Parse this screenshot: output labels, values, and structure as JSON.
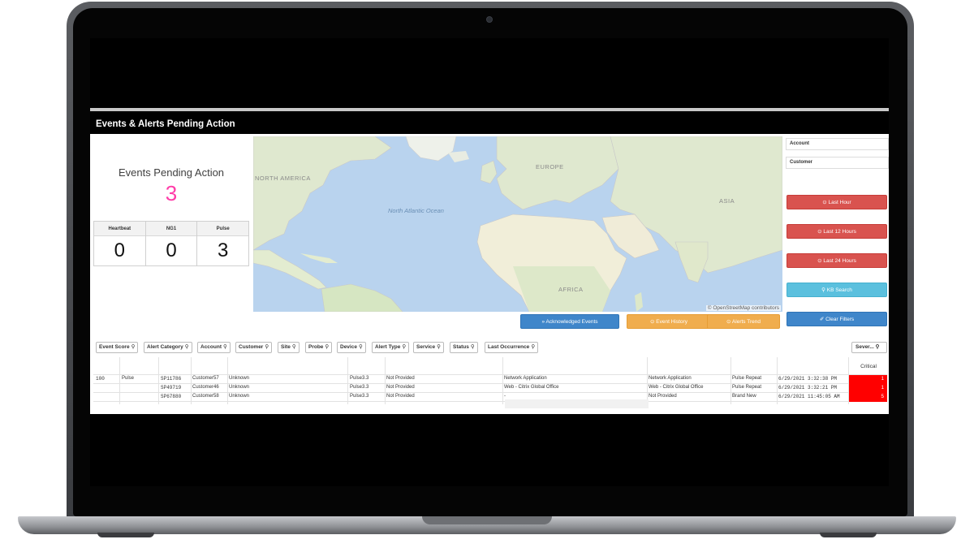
{
  "panel_title": "Events & Alerts Pending Action",
  "pending": {
    "title": "Events Pending Action",
    "value": "3",
    "value_color": "#ff3ca8"
  },
  "kpis": [
    {
      "label": "Heartbeat",
      "value": "0"
    },
    {
      "label": "NG1",
      "value": "0"
    },
    {
      "label": "Pulse",
      "value": "3"
    }
  ],
  "map": {
    "labels": {
      "north_america": "NORTH AMERICA",
      "europe": "EUROPE",
      "asia": "ASIA",
      "africa": "AFRICA"
    },
    "ocean": "North Atlantic Ocean",
    "attribution": "© OpenStreetMap contributors"
  },
  "filters": {
    "account": "Account",
    "customer": "Customer"
  },
  "buttons": {
    "last_hour": "Last Hour",
    "last_12_hours": "Last 12 Hours",
    "last_24_hours": "Last 24 Hours",
    "kb_search": "KB Search",
    "clear_filters": "Clear Filters",
    "acknowledged_events": "Acknowledged Events",
    "event_history": "Event History",
    "alerts_trend": "Alerts Trend"
  },
  "colors": {
    "red": "#d9534f",
    "cyan": "#5bc0de",
    "blue": "#3f86ca",
    "orange": "#f0ad4e",
    "severity": "#ff0000"
  },
  "table": {
    "headers": [
      "Event Score",
      "Alert Category",
      "Account",
      "Customer",
      "Site",
      "Probe",
      "Device",
      "Alert Type",
      "Service",
      "Status",
      "Last Occurrence"
    ],
    "severity_header": "Sever...",
    "severity_sub": "Critical",
    "score": "100",
    "category": "Pulse",
    "rows": [
      {
        "account": "SP11786",
        "customer": "Customer57",
        "site": "Unknown",
        "probe": "Pulse3.3",
        "device": "Not Provided",
        "alert_type": "Network Application",
        "service": "Network Application",
        "status": "Pulse Repeat",
        "last_occurrence": "6/29/2021 3:32:38 PM",
        "severity": "1"
      },
      {
        "account": "SP49719",
        "customer": "Customer46",
        "site": "Unknown",
        "probe": "Pulse3.3",
        "device": "Not Provided",
        "alert_type": "Web - Citrix Global Office",
        "service": "Web - Citrix Global Office",
        "status": "Pulse Repeat",
        "last_occurrence": "6/29/2021 3:32:21 PM",
        "severity": "1"
      },
      {
        "account": "SP67880",
        "customer": "Customer58",
        "site": "Unknown",
        "probe": "Pulse3.3",
        "device": "Not Provided",
        "alert_type": "-",
        "service": "Not Provided",
        "status": "Brand New",
        "last_occurrence": "6/29/2021 11:45:05 AM",
        "severity": "5"
      }
    ]
  }
}
